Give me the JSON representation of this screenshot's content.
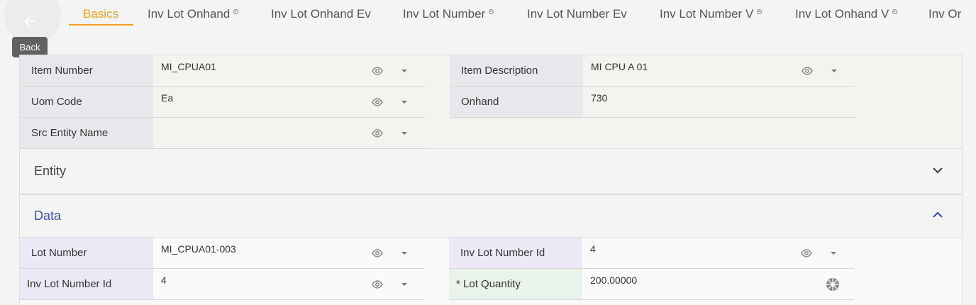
{
  "back": {
    "tooltip": "Back",
    "icon": "arrow-left-icon"
  },
  "tabs": [
    {
      "label": "Basics",
      "active": true,
      "dot": false
    },
    {
      "label": "Inv Lot Onhand",
      "active": false,
      "dot": true
    },
    {
      "label": "Inv Lot Onhand Ev",
      "active": false,
      "dot": false
    },
    {
      "label": "Inv Lot Number",
      "active": false,
      "dot": true
    },
    {
      "label": "Inv Lot Number Ev",
      "active": false,
      "dot": false
    },
    {
      "label": "Inv Lot Number V",
      "active": false,
      "dot": true
    },
    {
      "label": "Inv Lot Onhand V",
      "active": false,
      "dot": true
    },
    {
      "label": "Inv Or",
      "active": false,
      "dot": false
    }
  ],
  "basics": {
    "item_number": {
      "label": "Item Number",
      "value": "MI_CPUA01"
    },
    "item_description": {
      "label": "Item Description",
      "value": "MI CPU A 01"
    },
    "uom_code": {
      "label": "Uom Code",
      "value": "Ea"
    },
    "onhand": {
      "label": "Onhand",
      "value": "730"
    },
    "src_entity_name": {
      "label": "Src Entity Name",
      "value": ""
    }
  },
  "sections": {
    "entity": "Entity",
    "data": "Data"
  },
  "data": {
    "lot_number": {
      "label": "Lot Number",
      "value": "MI_CPUA01-003"
    },
    "inv_lot_number_id_right": {
      "label": "Inv Lot Number Id",
      "value": "4"
    },
    "inv_lot_number_id_left": {
      "label": "Inv Lot Number Id",
      "value": "4"
    },
    "lot_quantity": {
      "label": "* Lot Quantity",
      "value": "200.00000"
    }
  },
  "colors": {
    "accent": "#f29e1c",
    "section_active": "#3f51b5"
  }
}
